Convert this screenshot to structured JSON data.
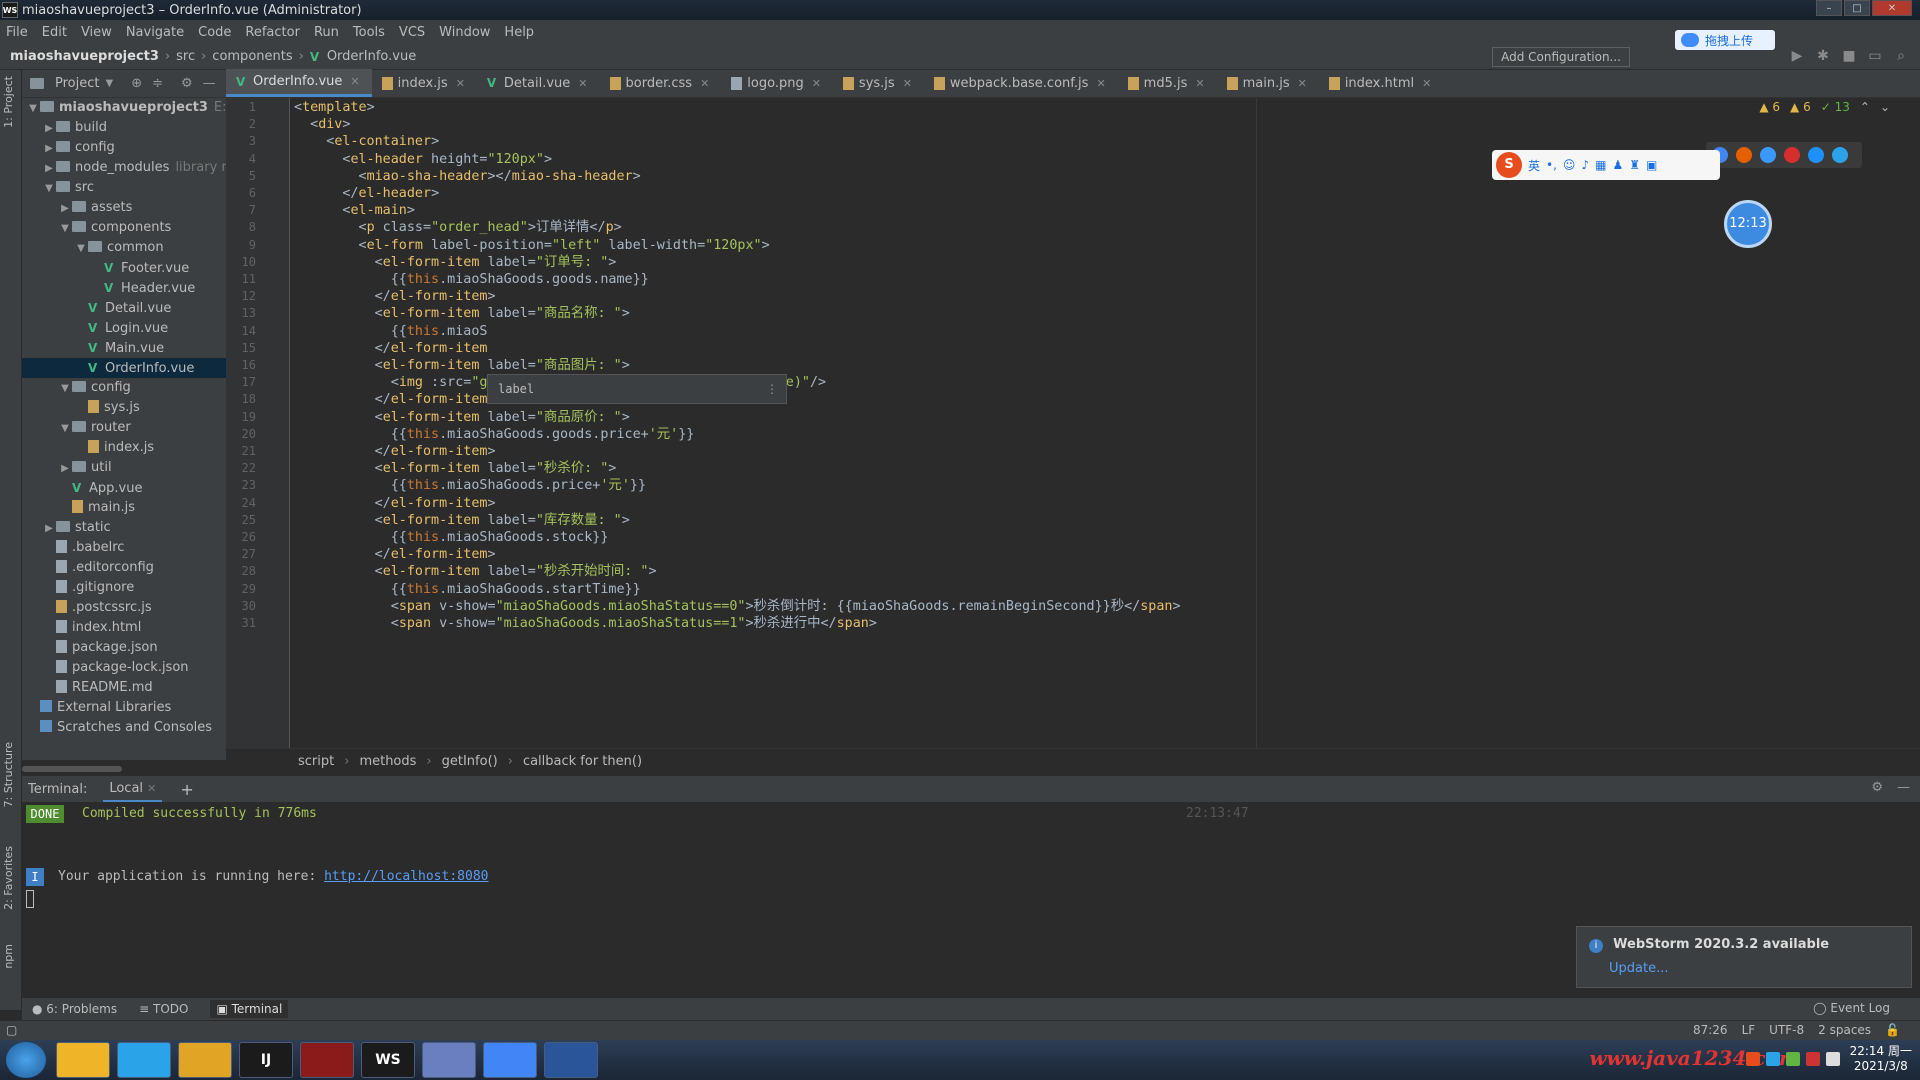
{
  "window": {
    "title": "miaoshavueproject3 – OrderInfo.vue (Administrator)",
    "logo": "WS"
  },
  "menu": [
    "File",
    "Edit",
    "View",
    "Navigate",
    "Code",
    "Refactor",
    "Run",
    "Tools",
    "VCS",
    "Window",
    "Help"
  ],
  "breadcrumb": [
    "miaoshavueproject3",
    "src",
    "components",
    "OrderInfo.vue"
  ],
  "toolbar": {
    "add_config": "Add Configuration...",
    "upload_label": "拖拽上传"
  },
  "project_panel": {
    "title": "Project",
    "strip_project": "1: Project",
    "strip_structure": "7: Structure",
    "strip_favorites": "2: Favorites",
    "strip_npm": "npm",
    "tree": [
      {
        "label": "miaoshavueproject3",
        "suffix": "E:\\wo",
        "kind": "folder",
        "depth": 0,
        "open": true,
        "bold": true
      },
      {
        "label": "build",
        "kind": "folder",
        "depth": 1,
        "open": false
      },
      {
        "label": "config",
        "kind": "folder",
        "depth": 1,
        "open": false
      },
      {
        "label": "node_modules",
        "suffix": "library ro",
        "kind": "folder",
        "depth": 1,
        "open": false
      },
      {
        "label": "src",
        "kind": "folder",
        "depth": 1,
        "open": true
      },
      {
        "label": "assets",
        "kind": "folder",
        "depth": 2,
        "open": false
      },
      {
        "label": "components",
        "kind": "folder",
        "depth": 2,
        "open": true
      },
      {
        "label": "common",
        "kind": "folder",
        "depth": 3,
        "open": true
      },
      {
        "label": "Footer.vue",
        "kind": "vue",
        "depth": 4
      },
      {
        "label": "Header.vue",
        "kind": "vue",
        "depth": 4
      },
      {
        "label": "Detail.vue",
        "kind": "vue",
        "depth": 3
      },
      {
        "label": "Login.vue",
        "kind": "vue",
        "depth": 3
      },
      {
        "label": "Main.vue",
        "kind": "vue",
        "depth": 3
      },
      {
        "label": "OrderInfo.vue",
        "kind": "vue",
        "depth": 3,
        "selected": true
      },
      {
        "label": "config",
        "kind": "folder",
        "depth": 2,
        "open": true
      },
      {
        "label": "sys.js",
        "kind": "js",
        "depth": 3
      },
      {
        "label": "router",
        "kind": "folder",
        "depth": 2,
        "open": true
      },
      {
        "label": "index.js",
        "kind": "js",
        "depth": 3
      },
      {
        "label": "util",
        "kind": "folder",
        "depth": 2,
        "open": false
      },
      {
        "label": "App.vue",
        "kind": "vue",
        "depth": 2
      },
      {
        "label": "main.js",
        "kind": "js",
        "depth": 2
      },
      {
        "label": "static",
        "kind": "folder",
        "depth": 1,
        "open": false
      },
      {
        "label": ".babelrc",
        "kind": "file",
        "depth": 1
      },
      {
        "label": ".editorconfig",
        "kind": "file",
        "depth": 1
      },
      {
        "label": ".gitignore",
        "kind": "file",
        "depth": 1
      },
      {
        "label": ".postcssrc.js",
        "kind": "js",
        "depth": 1
      },
      {
        "label": "index.html",
        "kind": "file",
        "depth": 1
      },
      {
        "label": "package.json",
        "kind": "file",
        "depth": 1
      },
      {
        "label": "package-lock.json",
        "kind": "file",
        "depth": 1
      },
      {
        "label": "README.md",
        "kind": "file",
        "depth": 1
      },
      {
        "label": "External Libraries",
        "kind": "lib",
        "depth": 0
      },
      {
        "label": "Scratches and Consoles",
        "kind": "lib",
        "depth": 0
      }
    ]
  },
  "editor_tabs": [
    {
      "label": "OrderInfo.vue",
      "kind": "vue",
      "active": true
    },
    {
      "label": "index.js",
      "kind": "js"
    },
    {
      "label": "Detail.vue",
      "kind": "vue"
    },
    {
      "label": "border.css",
      "kind": "js"
    },
    {
      "label": "logo.png",
      "kind": "file"
    },
    {
      "label": "sys.js",
      "kind": "js"
    },
    {
      "label": "webpack.base.conf.js",
      "kind": "js"
    },
    {
      "label": "md5.js",
      "kind": "js"
    },
    {
      "label": "main.js",
      "kind": "js"
    },
    {
      "label": "index.html",
      "kind": "js"
    }
  ],
  "inspections": {
    "warn1": "6",
    "warn2": "6",
    "ok": "13"
  },
  "code_lines": [
    "<template>",
    "  <div>",
    "    <el-container>",
    "      <el-header height=\"120px\">",
    "        <miao-sha-header></miao-sha-header>",
    "      </el-header>",
    "      <el-main>",
    "        <p class=\"order_head\">订单详情</p>",
    "        <el-form label-position=\"left\" label-width=\"120px\">",
    "          <el-form-item label=\"订单号: \">",
    "            {{this.miaoShaGoods.goods.name}}",
    "          </el-form-item>",
    "          <el-form-item label=\"商品名称: \">",
    "            {{this.miaoS",
    "          </el-form-item",
    "          <el-form-item label=\"商品图片: \">",
    "            <img :src=\"getSrcUrl(this.miaoShaGoods.goods.image)\"/>",
    "          </el-form-item>",
    "          <el-form-item label=\"商品原价: \">",
    "            {{this.miaoShaGoods.goods.price+'元'}}",
    "          </el-form-item>",
    "          <el-form-item label=\"秒杀价: \">",
    "            {{this.miaoShaGoods.price+'元'}}",
    "          </el-form-item>",
    "          <el-form-item label=\"库存数量: \">",
    "            {{this.miaoShaGoods.stock}}",
    "          </el-form-item>",
    "          <el-form-item label=\"秒杀开始时间: \">",
    "            {{this.miaoShaGoods.startTime}}",
    "            <span v-show=\"miaoShaGoods.miaoShaStatus==0\">秒杀倒计时: {{miaoShaGoods.remainBeginSecond}}秒</span>",
    "            <span v-show=\"miaoShaGoods.miaoShaStatus==1\">秒杀进行中</span>"
  ],
  "tooltip": {
    "text": "label"
  },
  "sogou": {
    "lang": "英",
    "label": "S"
  },
  "clock_bubble": "12:13",
  "editor_crumb": [
    "script",
    "methods",
    "getInfo()",
    "callback for then()"
  ],
  "terminal": {
    "title": "Terminal:",
    "tab": "Local",
    "done": "DONE",
    "compiled": "Compiled successfully in 776ms",
    "time": "22:13:47",
    "info": "I",
    "running_prefix": "Your application is running here: ",
    "url": "http://localhost:8080"
  },
  "notification": {
    "title": "WebStorm 2020.3.2 available",
    "action": "Update..."
  },
  "tool_windows": [
    "6: Problems",
    "TODO",
    "Terminal"
  ],
  "event_log": "Event Log",
  "status": {
    "pos": "87:26",
    "eol": "LF",
    "enc": "UTF-8",
    "indent": "2 spaces"
  },
  "taskbar": {
    "apps": [
      "",
      "",
      "",
      "IJ",
      "",
      "WS",
      "",
      "",
      ""
    ],
    "time": "22:14 周一",
    "date": "2021/3/8",
    "watermark": "www.java1234.com"
  }
}
